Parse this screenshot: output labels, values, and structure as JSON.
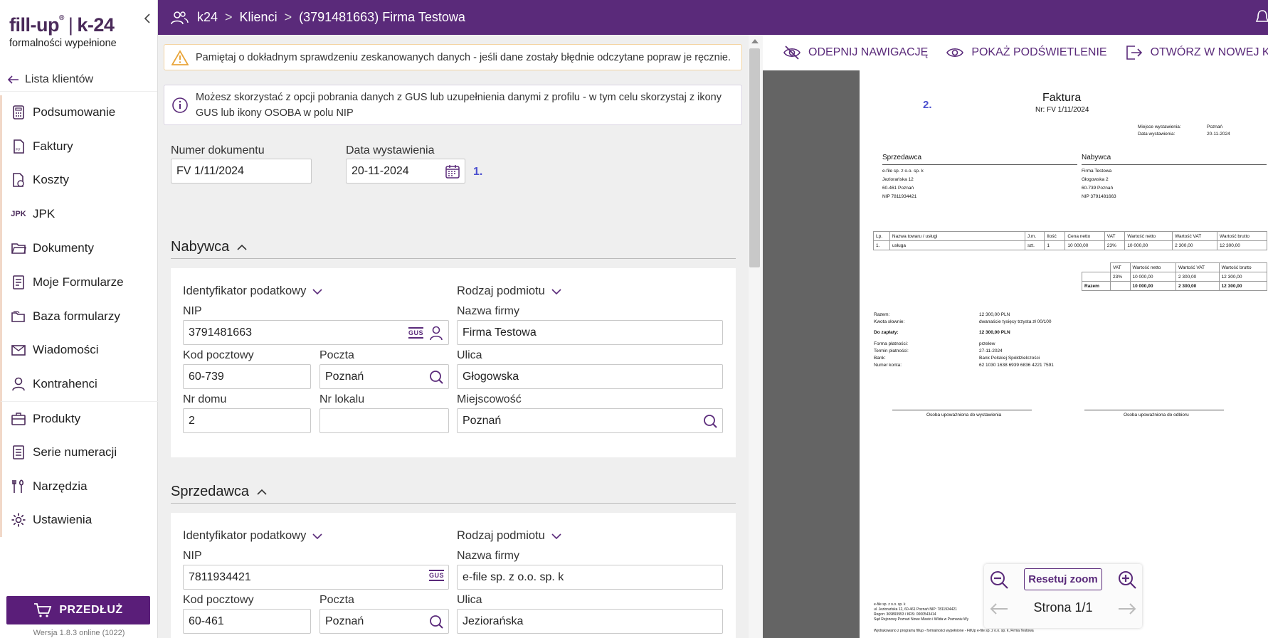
{
  "brand": {
    "logo_left": "fill-up",
    "logo_right": "k-24",
    "tagline": "formalności wypełnione"
  },
  "sidebar": {
    "back_label": "Lista klientów",
    "items": [
      {
        "label": "Podsumowanie",
        "icon": "calculator-icon"
      },
      {
        "label": "Faktury",
        "icon": "invoice-icon"
      },
      {
        "label": "Koszty",
        "icon": "costs-icon"
      },
      {
        "label": "JPK",
        "icon": "jpk-icon"
      },
      {
        "label": "Dokumenty",
        "icon": "folder-icon"
      },
      {
        "label": "Moje Formularze",
        "icon": "form-icon"
      },
      {
        "label": "Baza formularzy",
        "icon": "folders-icon"
      },
      {
        "label": "Wiadomości",
        "icon": "mail-icon"
      },
      {
        "label": "Kontrahenci",
        "icon": "person-icon"
      },
      {
        "label": "Produkty",
        "icon": "briefcase-icon"
      },
      {
        "label": "Serie numeracji",
        "icon": "list-icon"
      },
      {
        "label": "Narzędzia",
        "icon": "tools-icon"
      },
      {
        "label": "Ustawienia",
        "icon": "gear-icon"
      }
    ],
    "extend_label": "PRZEDŁUŻ",
    "version": "Wersja 1.8.3 online (1022)"
  },
  "topbar": {
    "crumbs": [
      "k24",
      "Klienci",
      "(3791481663) Firma Testowa"
    ]
  },
  "alerts": {
    "warning": "Pamiętaj o dokładnym sprawdzeniu zeskanowanych danych - jeśli dane zostały błędnie odczytane popraw je ręcznie.",
    "info": "Możesz skorzystać z opcji pobrania danych z GUS lub uzupełnienia danymi z profilu - w tym celu skorzystaj z ikony GUS lub ikony OSOBA w polu NIP"
  },
  "doc_fields": {
    "number_label": "Numer dokumentu",
    "number_value": "FV 1/11/2024",
    "date_label": "Data wystawienia",
    "date_value": "20-11-2024",
    "step1": "1."
  },
  "buyer": {
    "title": "Nabywca",
    "tax_id_type": "Identyfikator podatkowy",
    "entity_type": "Rodzaj podmiotu",
    "nip_label": "NIP",
    "nip": "3791481663",
    "company_label": "Nazwa firmy",
    "company": "Firma Testowa",
    "zip_label": "Kod pocztowy",
    "zip": "60-739",
    "post_label": "Poczta",
    "post": "Poznań",
    "street_label": "Ulica",
    "street": "Głogowska",
    "house_label": "Nr domu",
    "house": "2",
    "flat_label": "Nr lokalu",
    "flat": "",
    "city_label": "Miejscowość",
    "city": "Poznań"
  },
  "seller": {
    "title": "Sprzedawca",
    "tax_id_type": "Identyfikator podatkowy",
    "entity_type": "Rodzaj podmiotu",
    "nip_label": "NIP",
    "nip": "7811934421",
    "company_label": "Nazwa firmy",
    "company": "e-file sp. z o.o. sp. k",
    "zip_label": "Kod pocztowy",
    "zip": "60-461",
    "post_label": "Poczta",
    "post": "Poznań",
    "street_label": "Ulica",
    "street": "Jeziorańska"
  },
  "gus_label": "GUS",
  "preview_toolbar": {
    "unpin": "ODEPNIJ NAWIGACJĘ",
    "highlight": "POKAŻ PODŚWIETLENIE",
    "open_new": "OTWÓRZ W NOWEJ KARCIE"
  },
  "invoice": {
    "step2": "2.",
    "title": "Faktura",
    "number": "Nr: FV 1/11/2024",
    "place_label": "Miejsce wystawienia:",
    "place": "Poznań",
    "date_label": "Data wystawienia:",
    "date": "20-11-2024",
    "seller_h": "Sprzedawca",
    "buyer_h": "Nabywca",
    "seller_lines": [
      "e-file sp. z o.o. sp. k",
      "Jeziorańska 12",
      "60-461 Poznań",
      "NIP 7811934421"
    ],
    "buyer_lines": [
      "Firma Testowa",
      "Głogowska 2",
      "60-739 Poznań",
      "NIP 3791481663"
    ],
    "items_header": [
      "Lp.",
      "Nazwa towaru / usługi",
      "J.m.",
      "Ilość",
      "Cena netto",
      "VAT",
      "Wartość netto",
      "Wartość VAT",
      "Wartość brutto"
    ],
    "items_row": [
      "1.",
      "usługa",
      "szt.",
      "1",
      "10 000,00",
      "23%",
      "10 000,00",
      "2 300,00",
      "12 300,00"
    ],
    "sum_header": [
      "VAT",
      "Wartość netto",
      "Wartość VAT",
      "Wartość brutto"
    ],
    "sum_row": [
      "23%",
      "10 000,00",
      "2 300,00",
      "12 300,00"
    ],
    "sum_total": [
      "Razem",
      "",
      "10 000,00",
      "2 300,00",
      "12 300,00"
    ],
    "summary": [
      [
        "Razem:",
        "12 300,00 PLN"
      ],
      [
        "Kwota słownie:",
        "dwanaście  tysięcy  trzysta  zł 00/100"
      ],
      [
        "Do zapłaty:",
        "12 300,00 PLN"
      ],
      [
        "Forma płatności:",
        "przelew"
      ],
      [
        "Termin płatności:",
        "27-11-2024"
      ],
      [
        "Bank:",
        "Bank Polskiej Spółdzielczości"
      ],
      [
        "Numer konta:",
        "62 1030 1638 6939 6836 4221 7591"
      ]
    ],
    "sign_left": "Osoba upoważniona do wystawienia",
    "sign_right": "Osoba upoważniona do odbioru",
    "footer_lines": [
      "e-file sp. z o.o. sp. k",
      "ul. Jeziorańska 12, 60-461 Poznań NIP: 7811934421",
      "Regon: 369893953 / KRS: 0000543414",
      "Sąd Rejonowy Poznań Nowe Miasto i Wilda w Poznaniu Wy"
    ],
    "footer_note": "Wydrukowano z programu fillup - formalności wypełnione - FillUp e-file sp. z o.o. sp. k, Firma Testowa"
  },
  "zoom": {
    "reset": "Resetuj zoom",
    "page": "Strona 1/1"
  },
  "colors": {
    "brand_purple": "#5a2a7a",
    "button_purple": "#5a1e79",
    "accent_orange": "#e4572e",
    "step_blue": "#4b4fcf"
  }
}
